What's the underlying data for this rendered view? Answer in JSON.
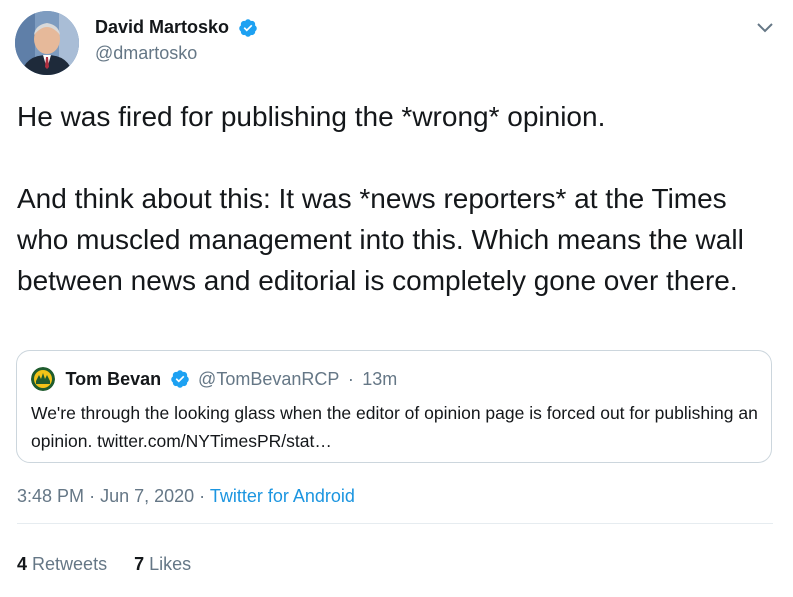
{
  "author": {
    "display_name": "David Martosko",
    "handle": "@dmartosko"
  },
  "tweet": {
    "text": "He was fired for publishing the *wrong* opinion.\n\nAnd think about this: It was *news reporters* at the Times who muscled management into this. Which means the wall between news and editorial is completely gone over there."
  },
  "quoted_tweet": {
    "display_name": "Tom Bevan",
    "handle": "@TomBevanRCP",
    "separator": "·",
    "time": "13m",
    "text": "We're through the looking glass when the editor of opinion page is forced out for publishing an opinion. twitter.com/NYTimesPR/stat…"
  },
  "meta": {
    "time": "3:48 PM",
    "sep1": "·",
    "date": "Jun 7, 2020",
    "sep2": "·",
    "source": "Twitter for Android"
  },
  "stats": {
    "retweets_count": "4",
    "retweets_label": "Retweets",
    "likes_count": "7",
    "likes_label": "Likes"
  },
  "colors": {
    "verified": "#1da1f2",
    "link": "#1b95e0",
    "secondary_text": "#657786"
  },
  "icons": {
    "verified": "verified-badge-icon",
    "menu": "chevron-down-icon"
  }
}
